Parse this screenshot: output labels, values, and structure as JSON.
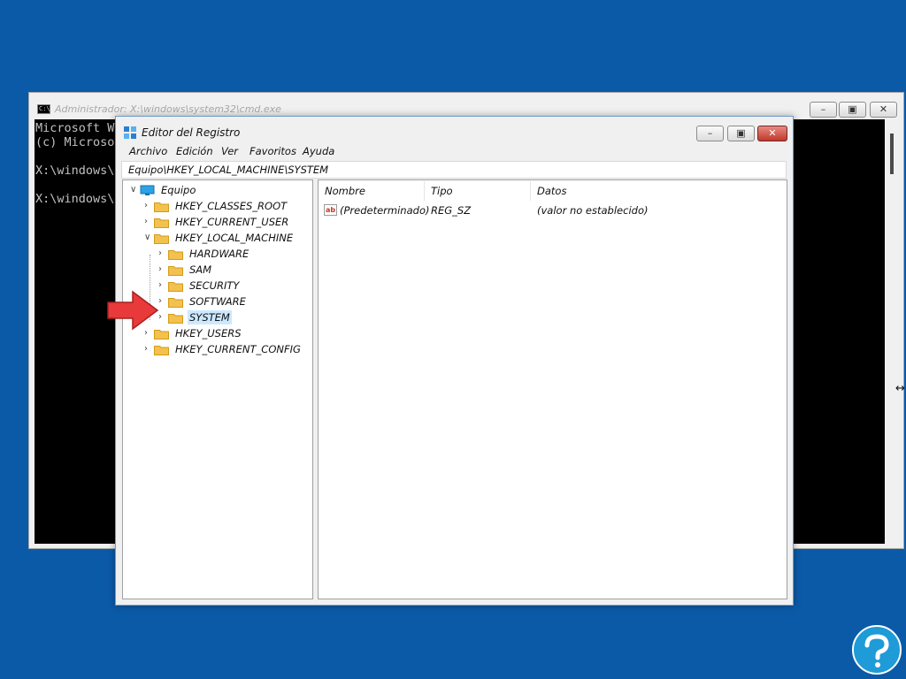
{
  "cmd_window": {
    "title": "Administrador: X:\\windows\\system32\\cmd.exe",
    "lines": [
      "Microsoft Wi",
      "(c) Microsof",
      "",
      "X:\\windows\\s",
      "",
      "X:\\windows\\s"
    ],
    "buttons": {
      "minimize": "–",
      "maximize": "▣",
      "close": "✕"
    }
  },
  "regedit": {
    "title": "Editor del Registro",
    "buttons": {
      "minimize": "–",
      "maximize": "▣",
      "close": "✕"
    },
    "menu": [
      "Archivo",
      "Edición",
      "Ver",
      "Favoritos",
      "Ayuda"
    ],
    "address": "Equipo\\HKEY_LOCAL_MACHINE\\SYSTEM",
    "tree": {
      "root": "Equipo",
      "hives": [
        "HKEY_CLASSES_ROOT",
        "HKEY_CURRENT_USER",
        "HKEY_LOCAL_MACHINE",
        "HKEY_USERS",
        "HKEY_CURRENT_CONFIG"
      ],
      "hklm_children": [
        "HARDWARE",
        "SAM",
        "SECURITY",
        "SOFTWARE",
        "SYSTEM"
      ],
      "selected": "SYSTEM"
    },
    "list": {
      "columns": [
        "Nombre",
        "Tipo",
        "Datos"
      ],
      "rows": [
        {
          "name": "(Predeterminado)",
          "type": "REG_SZ",
          "data": "(valor no establecido)",
          "icon": "ab-string-icon"
        }
      ]
    }
  },
  "colors": {
    "desktop": "#0b5aa8",
    "selection": "#cce8ff",
    "folder": "#f2c14e",
    "arrow": "#e83a3a",
    "logo": "#1f9bd7"
  }
}
